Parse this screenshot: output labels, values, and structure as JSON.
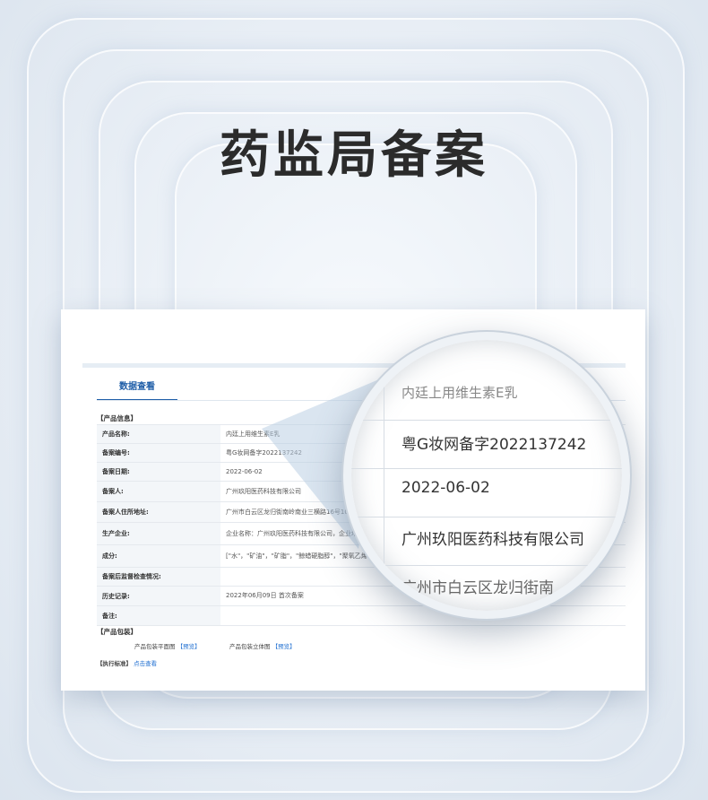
{
  "headline": "药监局备案",
  "tab": {
    "label": "数据查看"
  },
  "sections": {
    "product_info": "【产品信息】",
    "packaging": "【产品包装】",
    "standard": "【执行标准】"
  },
  "rows": [
    {
      "label": "产品名称:",
      "value": "内廷上用维生素E乳"
    },
    {
      "label": "备案编号:",
      "value": "粤G妆网备字2022137242"
    },
    {
      "label": "备案日期:",
      "value": "2022-06-02"
    },
    {
      "label": "备案人:",
      "value": "广州玖阳医药科技有限公司"
    },
    {
      "label": "备案人住所地址:",
      "value": "广州市白云区龙归街南岭南业三横路16号101房"
    },
    {
      "label": "生产企业:",
      "value": "企业名称：广州玖阳医药科技有限公司，企业地址：…横路16号3楼、4楼 生产许可证：粤妆20200114"
    },
    {
      "label": "成分:",
      "value": "[\"水\"，\"矿油\"，\"矿脂\"，\"鲸蜡硬脂醇\"，\"聚氧乙烯…苯丙酯\"，\"生育酚（维生素E）\"，\"C13-14 异链烷烃\"…]"
    },
    {
      "label": "备案后监督检查情况:",
      "value": ""
    },
    {
      "label": "历史记录:",
      "value": "2022年06月09日 首次备案"
    },
    {
      "label": "备注:",
      "value": ""
    }
  ],
  "packaging": {
    "flat_label": "产品包装平面图",
    "flat_link": "【预览】",
    "solid_label": "产品包装立体图",
    "solid_link": "【预览】"
  },
  "standard_link": "点击查看",
  "lens_lines": [
    "内廷上用维生素E乳",
    "粤G妆网备字2022137242",
    "2022-06-02",
    "广州玖阳医药科技有限公司",
    "广州市白云区龙归街南"
  ]
}
